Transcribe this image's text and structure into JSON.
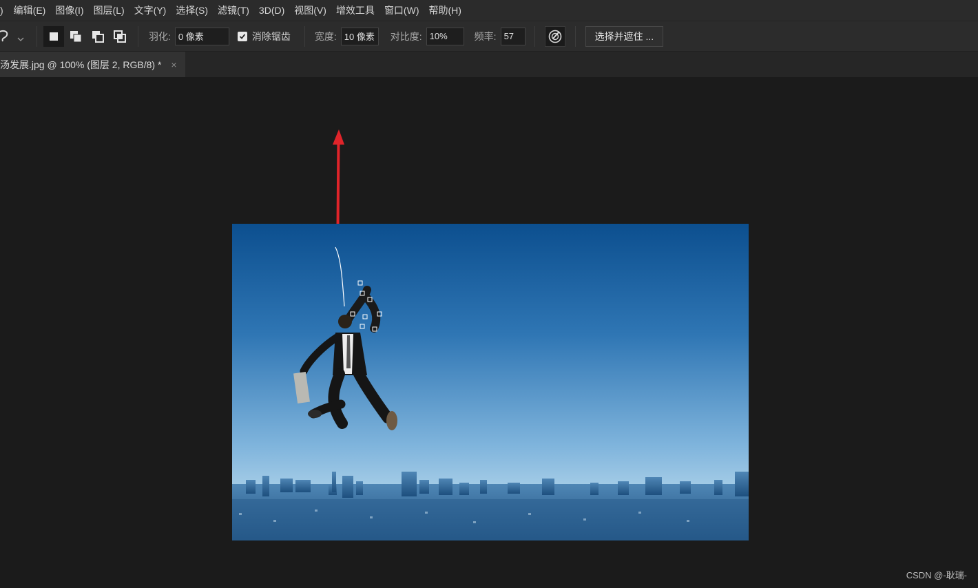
{
  "menu": {
    "items": [
      "编辑(E)",
      "图像(I)",
      "图层(L)",
      "文字(Y)",
      "选择(S)",
      "滤镜(T)",
      "3D(D)",
      "视图(V)",
      "增效工具",
      "窗口(W)",
      "帮助(H)"
    ],
    "partial_first": ")"
  },
  "options": {
    "feather_label": "羽化:",
    "feather_value": "0 像素",
    "antialias_label": "消除锯齿",
    "width_label": "宽度:",
    "width_value": "10 像素",
    "contrast_label": "对比度:",
    "contrast_value": "10%",
    "frequency_label": "频率:",
    "frequency_value": "57",
    "select_mask_label": "选择并遮住 ..."
  },
  "document_tab": {
    "title": "汤发展.jpg @ 100% (图层 2, RGB/8) *",
    "close": "×"
  },
  "watermark": "CSDN @-耿瑞-",
  "colors": {
    "annotation_arrow": "#e0242a",
    "sky_top": "#0c4f8f",
    "sky_bottom": "#a9cfe8"
  },
  "icons": [
    "magnetic-lasso-icon",
    "new-selection-icon",
    "add-selection-icon",
    "subtract-selection-icon",
    "intersect-selection-icon",
    "checkbox-checked-icon",
    "pen-pressure-icon",
    "close-icon"
  ]
}
